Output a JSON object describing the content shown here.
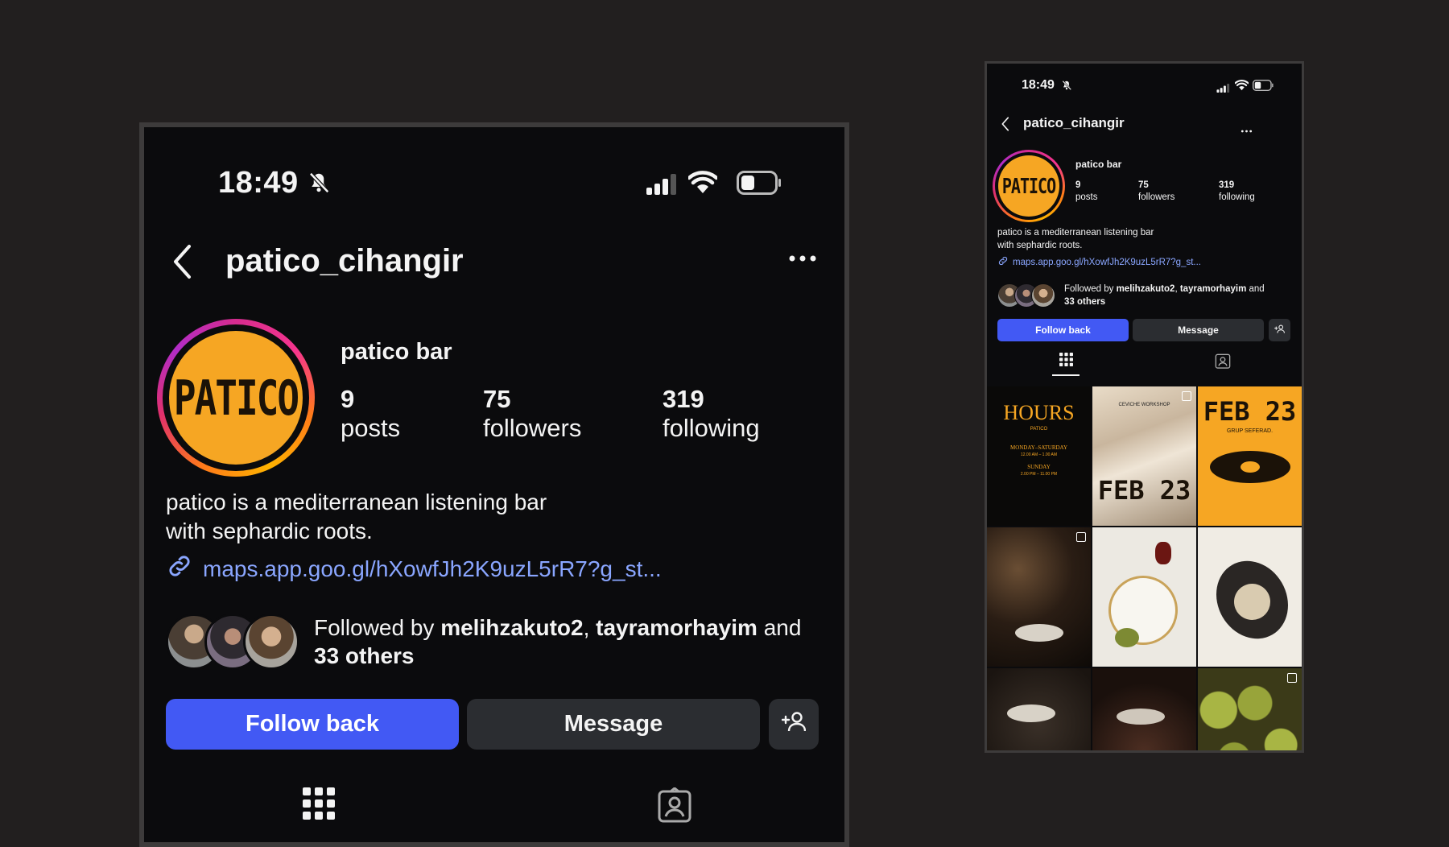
{
  "status_bar": {
    "time": "18:49"
  },
  "profile": {
    "username": "patico_cihangir",
    "display_name": "patico bar",
    "avatar_text": "PATICO",
    "stats": [
      {
        "value": "9",
        "label": "posts"
      },
      {
        "value": "75",
        "label": "followers"
      },
      {
        "value": "319",
        "label": "following"
      }
    ],
    "bio_line1": "patico is a mediterranean listening bar",
    "bio_line2": "with sephardic roots.",
    "link": "maps.app.goo.gl/hXowfJh2K9uzL5rR7?g_st...",
    "followed_by_prefix": "Followed by",
    "followed_by_user1": "melihzakuto2",
    "followed_by_sep": ",",
    "followed_by_user2": "tayramorhayim",
    "followed_by_and": "and",
    "followed_by_others": "33 others"
  },
  "actions": {
    "follow_back": "Follow back",
    "message": "Message"
  },
  "small_link": "maps.app.goo.gl/hXowfJh2K9uzL5rR7?g_st...",
  "grid_posts": [
    {
      "title": "HOURS",
      "sub": "PATICO",
      "line1": "MONDAY–SATURDAY",
      "line2": "12.00 AM – 1.00 AM",
      "line3": "SUNDAY",
      "line4": "2.00 PM – 11.00 PM"
    },
    {
      "title": "FEB 23",
      "sub": "CEVICHE WORKSHOP"
    },
    {
      "title": "FEB 23",
      "sub": "GRUP SEFERAD."
    }
  ],
  "colors": {
    "accent": "#4259f4",
    "link": "#8aa6ff",
    "avatar_fill": "#f6a623",
    "background": "#0b0b0d",
    "canvas": "#221f1f"
  },
  "icons": [
    "bell-slash-icon",
    "signal-icon",
    "wifi-icon",
    "battery-icon",
    "back-chevron-icon",
    "more-icon",
    "link-icon",
    "add-user-icon",
    "grid-icon",
    "tagged-icon"
  ]
}
